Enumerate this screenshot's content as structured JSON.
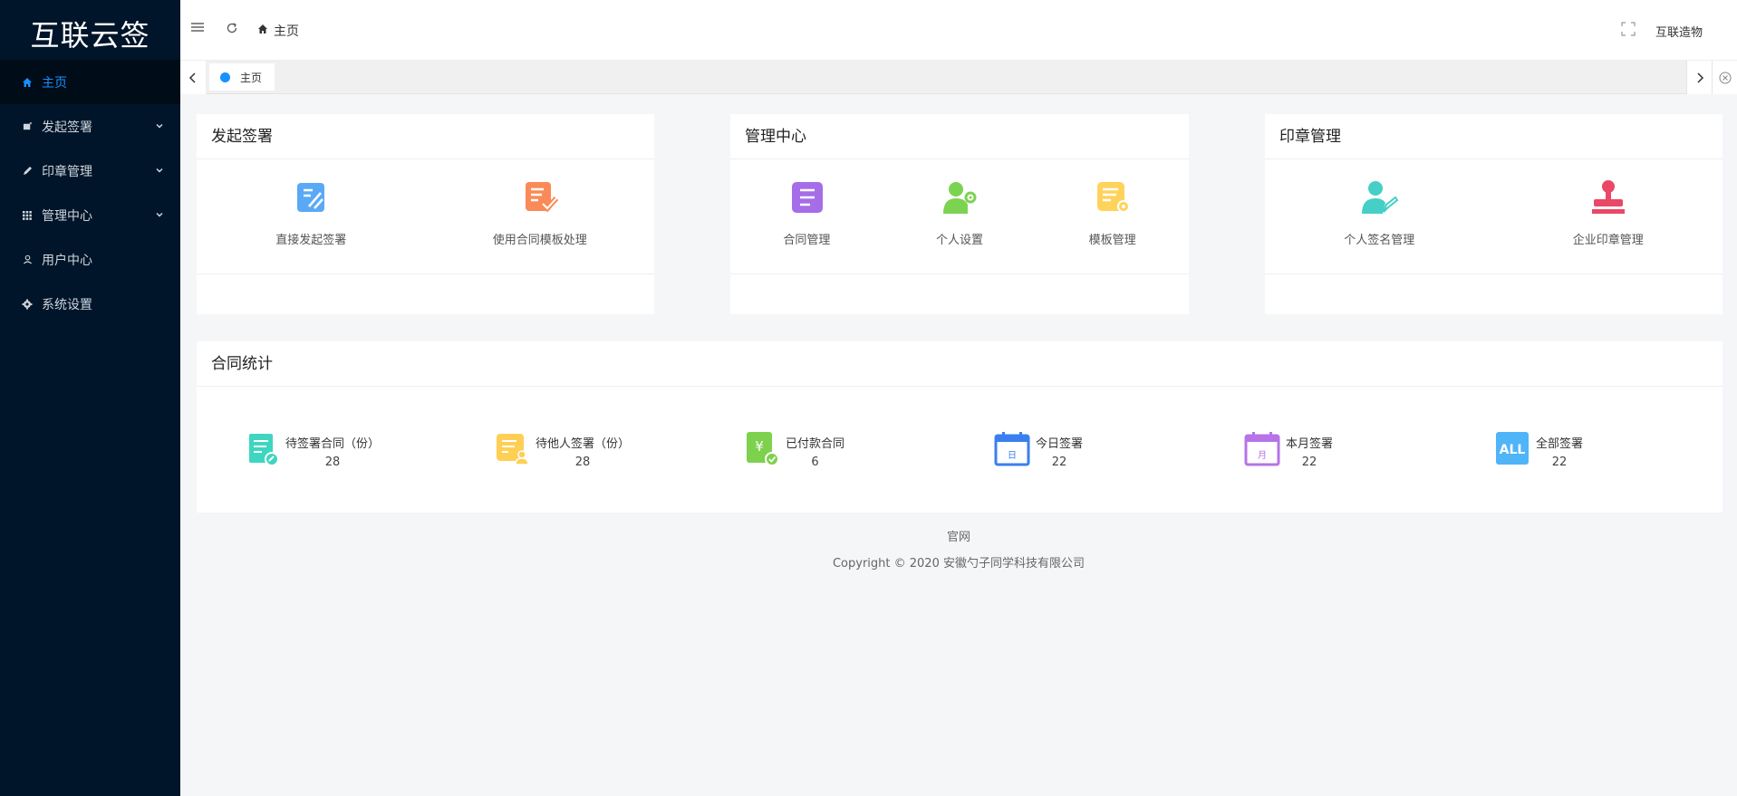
{
  "app": {
    "logo": "互联云签"
  },
  "sidebar": {
    "items": [
      {
        "label": "主页",
        "icon": "home-icon",
        "active": true
      },
      {
        "label": "发起签署",
        "icon": "sign-icon",
        "expandable": true
      },
      {
        "label": "印章管理",
        "icon": "pen-icon",
        "expandable": true
      },
      {
        "label": "管理中心",
        "icon": "grid-icon",
        "expandable": true
      },
      {
        "label": "用户中心",
        "icon": "user-icon"
      },
      {
        "label": "系统设置",
        "icon": "gear-icon"
      }
    ]
  },
  "header": {
    "breadcrumb": "主页",
    "user": "互联造物"
  },
  "tabs": [
    {
      "label": "主页"
    }
  ],
  "cards": {
    "sign": {
      "title": "发起签署",
      "tiles": [
        {
          "label": "直接发起签署",
          "icon": "direct-sign-icon"
        },
        {
          "label": "使用合同模板处理",
          "icon": "template-sign-icon"
        }
      ]
    },
    "manage": {
      "title": "管理中心",
      "tiles": [
        {
          "label": "合同管理",
          "icon": "contract-icon"
        },
        {
          "label": "个人设置",
          "icon": "user-settings-icon"
        },
        {
          "label": "模板管理",
          "icon": "template-settings-icon"
        }
      ]
    },
    "seal": {
      "title": "印章管理",
      "tiles": [
        {
          "label": "个人签名管理",
          "icon": "signature-icon"
        },
        {
          "label": "企业印章管理",
          "icon": "stamp-icon"
        }
      ]
    }
  },
  "stats": {
    "title": "合同统计",
    "items": [
      {
        "label": "待签署合同（份）",
        "value": "28",
        "icon": "pending-sign-icon"
      },
      {
        "label": "待他人签署（份）",
        "value": "28",
        "icon": "others-sign-icon"
      },
      {
        "label": "已付款合同",
        "value": "6",
        "icon": "paid-icon"
      },
      {
        "label": "今日签署",
        "value": "22",
        "icon": "calendar-day-icon",
        "glyph": "日"
      },
      {
        "label": "本月签署",
        "value": "22",
        "icon": "calendar-month-icon",
        "glyph": "月"
      },
      {
        "label": "全部签署",
        "value": "22",
        "icon": "all-icon",
        "glyph": "ALL"
      }
    ]
  },
  "footer": {
    "link": "官网",
    "copyright": "Copyright © 2020 安徽勺子同学科技有限公司"
  },
  "colors": {
    "sidebar_bg": "#001529",
    "accent": "#1890ff"
  }
}
